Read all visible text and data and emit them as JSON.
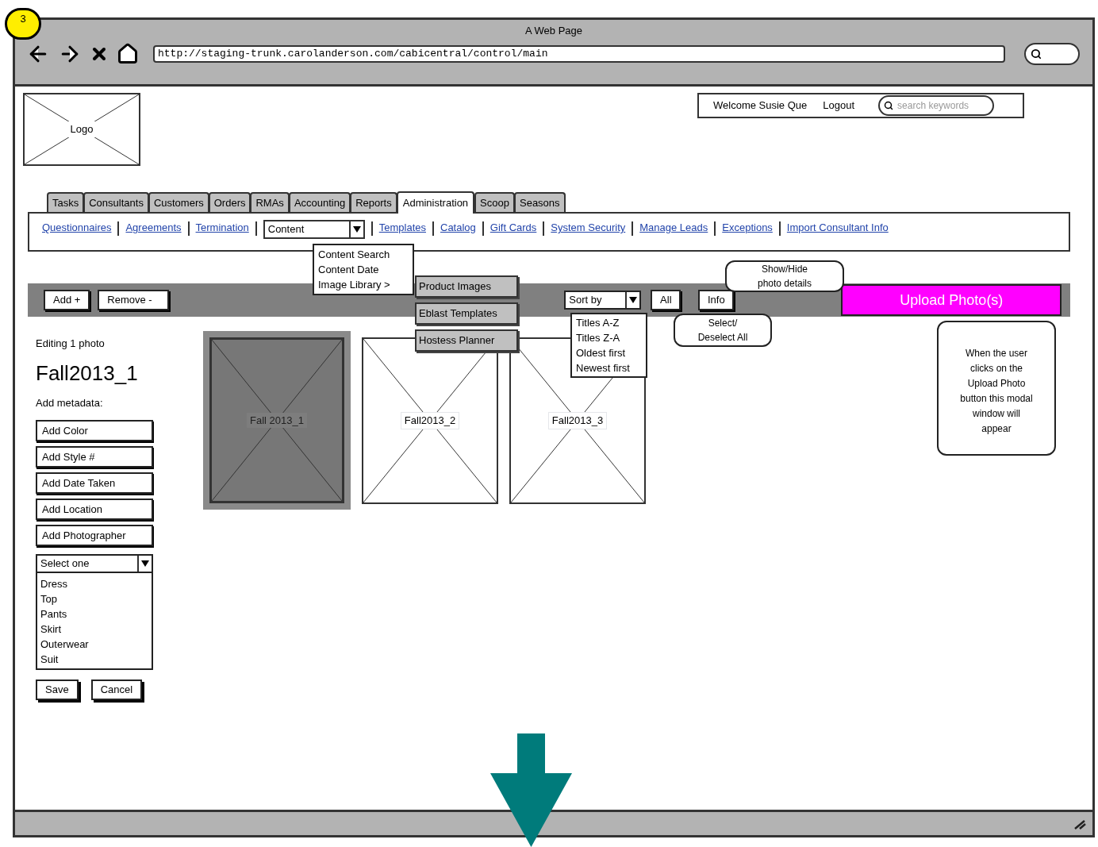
{
  "badge": "3",
  "window": {
    "title": "A Web Page",
    "url": "http://staging-trunk.carolanderson.com/cabicentral/control/main"
  },
  "header": {
    "logo": "Logo",
    "welcome": "Welcome Susie Que",
    "logout": "Logout",
    "search": {
      "placeholder": "search keywords"
    }
  },
  "tabs": [
    {
      "label": "Tasks",
      "selected": false
    },
    {
      "label": "Consultants",
      "selected": false
    },
    {
      "label": "Customers",
      "selected": false
    },
    {
      "label": "Orders",
      "selected": false
    },
    {
      "label": "RMAs",
      "selected": false
    },
    {
      "label": "Accounting",
      "selected": false
    },
    {
      "label": "Reports",
      "selected": false
    },
    {
      "label": "Administration",
      "selected": true
    },
    {
      "label": "Scoop",
      "selected": false
    },
    {
      "label": "Seasons",
      "selected": false
    }
  ],
  "subnav": [
    {
      "kind": "link",
      "label": "Questionnaires"
    },
    {
      "kind": "link",
      "label": "Agreements"
    },
    {
      "kind": "link",
      "label": "Termination"
    },
    {
      "kind": "dropdown",
      "label": "Content"
    },
    {
      "kind": "link",
      "label": "Templates"
    },
    {
      "kind": "link",
      "label": "Catalog"
    },
    {
      "kind": "link",
      "label": "Gift Cards"
    },
    {
      "kind": "link",
      "label": "System Security"
    },
    {
      "kind": "link",
      "label": "Manage Leads"
    },
    {
      "kind": "link",
      "label": "Exceptions"
    },
    {
      "kind": "link",
      "label": "Import Consultant Info"
    }
  ],
  "content_menu": {
    "items": [
      "Content Search",
      "Content Date",
      "Image Library >"
    ],
    "submenu": [
      "Product Images",
      "Eblast Templates",
      "Hostess Planner"
    ]
  },
  "toolbar": {
    "add": "Add +",
    "remove": "Remove -",
    "sort": {
      "value": "Sort by",
      "options": [
        "Titles A-Z",
        "Titles Z-A",
        "Oldest first",
        "Newest first"
      ]
    },
    "all": "All",
    "info": "Info",
    "upload": "Upload Photo(s)"
  },
  "callouts": [
    "Show/Hide photo details",
    "Select/ Deselect All",
    "When the user clicks on the Upload Photo button this modal window will appear"
  ],
  "editor": {
    "status": "Editing 1 photo",
    "title": "Fall2013_1",
    "metadata_label": "Add metadata:",
    "fields": [
      {
        "placeholder": "Add Color"
      },
      {
        "placeholder": "Add Style #"
      },
      {
        "placeholder": "Add Date Taken"
      },
      {
        "placeholder": "Add Location"
      },
      {
        "placeholder": "Add Photographer"
      }
    ],
    "category": {
      "value": "Select one",
      "options": [
        "Dress",
        "Top",
        "Pants",
        "Skirt",
        "Outerwear",
        "Suit"
      ]
    },
    "buttons": [
      "Save",
      "Cancel"
    ]
  },
  "photos": [
    {
      "label": "Fall 2013_1",
      "selected": true
    },
    {
      "label": "Fall2013_2",
      "selected": false
    },
    {
      "label": "Fall2013_3",
      "selected": false
    }
  ]
}
